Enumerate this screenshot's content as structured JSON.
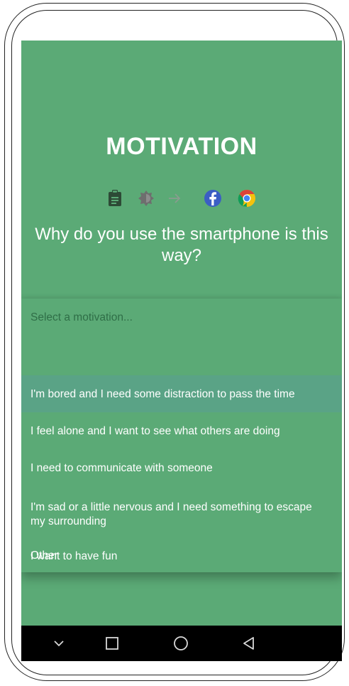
{
  "screen": {
    "title": "MOTIVATION",
    "question": "Why do you use the smartphone is this way?",
    "icons": [
      "clipboard-icon",
      "brightness-icon",
      "arrow-right-icon",
      "facebook-icon",
      "chrome-icon"
    ]
  },
  "dropdown": {
    "placeholder": "Select a motivation...",
    "options": [
      "I'm bored and I need some distraction to pass the time",
      "I feel alone and I want to see what others are doing",
      "I need to communicate with someone",
      "I'm sad or a little nervous and I need something to escape my surrounding",
      "I want to have fun",
      "Other"
    ],
    "selected_index": 0
  },
  "nav": {
    "buttons": [
      "chevron-down-icon",
      "recents-icon",
      "home-icon",
      "back-icon"
    ]
  },
  "colors": {
    "background": "#5baa76",
    "selected_row": "#5aa386",
    "placeholder_text": "#2f6e47",
    "nav_bar": "#000000"
  }
}
